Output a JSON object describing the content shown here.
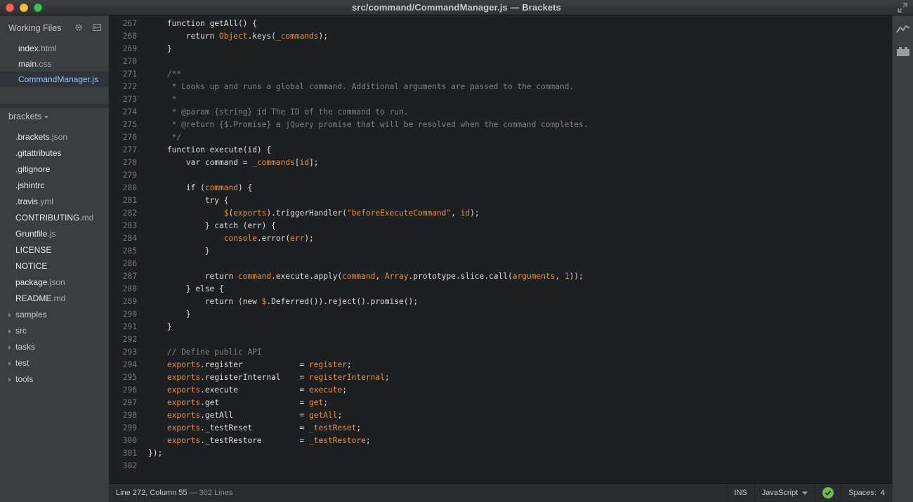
{
  "window": {
    "title": "src/command/CommandManager.js — Brackets"
  },
  "sidebar": {
    "working_files_title": "Working Files",
    "working_files": [
      {
        "name": "index",
        "ext": ".html",
        "selected": false
      },
      {
        "name": "main",
        "ext": ".css",
        "selected": false
      },
      {
        "name": "CommandManager",
        "ext": ".js",
        "selected": true
      }
    ],
    "project_title": "brackets",
    "tree": [
      {
        "name": ".brackets",
        "ext": ".json",
        "folder": false
      },
      {
        "name": ".gitattributes",
        "ext": "",
        "folder": false
      },
      {
        "name": ".gitignore",
        "ext": "",
        "folder": false
      },
      {
        "name": ".jshintrc",
        "ext": "",
        "folder": false
      },
      {
        "name": ".travis",
        "ext": ".yml",
        "folder": false
      },
      {
        "name": "CONTRIBUTING",
        "ext": ".md",
        "folder": false
      },
      {
        "name": "Gruntfile",
        "ext": ".js",
        "folder": false
      },
      {
        "name": "LICENSE",
        "ext": "",
        "folder": false
      },
      {
        "name": "NOTICE",
        "ext": "",
        "folder": false
      },
      {
        "name": "package",
        "ext": ".json",
        "folder": false
      },
      {
        "name": "README",
        "ext": ".md",
        "folder": false
      },
      {
        "name": "samples",
        "ext": "",
        "folder": true
      },
      {
        "name": "src",
        "ext": "",
        "folder": true
      },
      {
        "name": "tasks",
        "ext": "",
        "folder": true
      },
      {
        "name": "test",
        "ext": "",
        "folder": true
      },
      {
        "name": "tools",
        "ext": "",
        "folder": true
      }
    ]
  },
  "editor": {
    "lines": [
      {
        "n": "267",
        "t": [
          [
            "    function ",
            "p"
          ],
          [
            "getAll",
            "p"
          ],
          [
            "() {",
            "p"
          ]
        ]
      },
      {
        "n": "268",
        "t": [
          [
            "        return ",
            "p"
          ],
          [
            "Object",
            "v"
          ],
          [
            ".keys(",
            "p"
          ],
          [
            "_commands",
            "v"
          ],
          [
            ");",
            "p"
          ]
        ]
      },
      {
        "n": "269",
        "t": [
          [
            "    }",
            "p"
          ]
        ]
      },
      {
        "n": "270",
        "t": []
      },
      {
        "n": "271",
        "t": [
          [
            "    /**",
            "c"
          ]
        ]
      },
      {
        "n": "272",
        "t": [
          [
            "     * Looks up and runs a global command. Additional arguments are passed to the command.",
            "c"
          ]
        ]
      },
      {
        "n": "273",
        "t": [
          [
            "     *",
            "c"
          ]
        ]
      },
      {
        "n": "274",
        "t": [
          [
            "     * @param {string} id The ID of the command to run.",
            "c"
          ]
        ]
      },
      {
        "n": "275",
        "t": [
          [
            "     * @return {$.Promise} a jQuery promise that will be resolved when the command completes.",
            "c"
          ]
        ]
      },
      {
        "n": "276",
        "t": [
          [
            "     */",
            "c"
          ]
        ]
      },
      {
        "n": "277",
        "t": [
          [
            "    function ",
            "p"
          ],
          [
            "execute",
            "p"
          ],
          [
            "(id) {",
            "p"
          ]
        ]
      },
      {
        "n": "278",
        "t": [
          [
            "        var ",
            "p"
          ],
          [
            "command",
            "p"
          ],
          [
            " = ",
            "p"
          ],
          [
            "_commands",
            "v"
          ],
          [
            "[",
            "p"
          ],
          [
            "id",
            "v"
          ],
          [
            "];",
            "p"
          ]
        ]
      },
      {
        "n": "279",
        "t": []
      },
      {
        "n": "280",
        "t": [
          [
            "        if (",
            "p"
          ],
          [
            "command",
            "v"
          ],
          [
            ") {",
            "p"
          ]
        ]
      },
      {
        "n": "281",
        "t": [
          [
            "            try {",
            "p"
          ]
        ]
      },
      {
        "n": "282",
        "t": [
          [
            "                ",
            "p"
          ],
          [
            "$",
            "v"
          ],
          [
            "(",
            "p"
          ],
          [
            "exports",
            "v"
          ],
          [
            ").triggerHandler(",
            "p"
          ],
          [
            "\"beforeExecuteCommand\"",
            "v"
          ],
          [
            ", ",
            "p"
          ],
          [
            "id",
            "v"
          ],
          [
            ");",
            "p"
          ]
        ]
      },
      {
        "n": "283",
        "t": [
          [
            "            } catch (err) {",
            "p"
          ]
        ]
      },
      {
        "n": "284",
        "t": [
          [
            "                ",
            "p"
          ],
          [
            "console",
            "v"
          ],
          [
            ".error(",
            "p"
          ],
          [
            "err",
            "v"
          ],
          [
            ");",
            "p"
          ]
        ]
      },
      {
        "n": "285",
        "t": [
          [
            "            }",
            "p"
          ]
        ]
      },
      {
        "n": "286",
        "t": []
      },
      {
        "n": "287",
        "t": [
          [
            "            return ",
            "p"
          ],
          [
            "command",
            "v"
          ],
          [
            ".execute.apply(",
            "p"
          ],
          [
            "command",
            "v"
          ],
          [
            ", ",
            "p"
          ],
          [
            "Array",
            "v"
          ],
          [
            ".prototype.slice.call(",
            "p"
          ],
          [
            "arguments",
            "v"
          ],
          [
            ", ",
            "p"
          ],
          [
            "1",
            "v"
          ],
          [
            "));",
            "p"
          ]
        ]
      },
      {
        "n": "288",
        "t": [
          [
            "        } else {",
            "p"
          ]
        ]
      },
      {
        "n": "289",
        "t": [
          [
            "            return (new ",
            "p"
          ],
          [
            "$",
            "v"
          ],
          [
            ".Deferred()).reject().promise();",
            "p"
          ]
        ]
      },
      {
        "n": "290",
        "t": [
          [
            "        }",
            "p"
          ]
        ]
      },
      {
        "n": "291",
        "t": [
          [
            "    }",
            "p"
          ]
        ]
      },
      {
        "n": "292",
        "t": []
      },
      {
        "n": "293",
        "t": [
          [
            "    // Define public API",
            "c"
          ]
        ]
      },
      {
        "n": "294",
        "t": [
          [
            "    ",
            "p"
          ],
          [
            "exports",
            "v"
          ],
          [
            ".register            = ",
            "p"
          ],
          [
            "register",
            "v"
          ],
          [
            ";",
            "p"
          ]
        ]
      },
      {
        "n": "295",
        "t": [
          [
            "    ",
            "p"
          ],
          [
            "exports",
            "v"
          ],
          [
            ".registerInternal    = ",
            "p"
          ],
          [
            "registerInternal",
            "v"
          ],
          [
            ";",
            "p"
          ]
        ]
      },
      {
        "n": "296",
        "t": [
          [
            "    ",
            "p"
          ],
          [
            "exports",
            "v"
          ],
          [
            ".execute             = ",
            "p"
          ],
          [
            "execute",
            "v"
          ],
          [
            ";",
            "p"
          ]
        ]
      },
      {
        "n": "297",
        "t": [
          [
            "    ",
            "p"
          ],
          [
            "exports",
            "v"
          ],
          [
            ".get                 = ",
            "p"
          ],
          [
            "get",
            "v"
          ],
          [
            ";",
            "p"
          ]
        ]
      },
      {
        "n": "298",
        "t": [
          [
            "    ",
            "p"
          ],
          [
            "exports",
            "v"
          ],
          [
            ".getAll              = ",
            "p"
          ],
          [
            "getAll",
            "v"
          ],
          [
            ";",
            "p"
          ]
        ]
      },
      {
        "n": "299",
        "t": [
          [
            "    ",
            "p"
          ],
          [
            "exports",
            "v"
          ],
          [
            "._testReset          = ",
            "p"
          ],
          [
            "_testReset",
            "v"
          ],
          [
            ";",
            "p"
          ]
        ]
      },
      {
        "n": "300",
        "t": [
          [
            "    ",
            "p"
          ],
          [
            "exports",
            "v"
          ],
          [
            "._testRestore        = ",
            "p"
          ],
          [
            "_testRestore",
            "v"
          ],
          [
            ";",
            "p"
          ]
        ]
      },
      {
        "n": "301",
        "t": [
          [
            "});",
            "p"
          ]
        ]
      },
      {
        "n": "302",
        "t": []
      }
    ]
  },
  "statusbar": {
    "cursor": "Line 272, Column 55",
    "lines": " — 302 Lines",
    "mode": "INS",
    "language": "JavaScript",
    "spaces_label": "Spaces:",
    "spaces_value": "4"
  },
  "colors": {
    "accent": "#e8913b",
    "comment": "#7b8185",
    "selected_file": "#8fc4ef",
    "lint_ok": "#6bbf4a"
  },
  "icons": {
    "settings": "gear-icon",
    "split_view": "split-view-icon",
    "live_preview": "live-preview-icon",
    "extension_manager": "extension-manager-icon",
    "lint_status": "check-circle-icon",
    "fullscreen": "fullscreen-icon"
  }
}
